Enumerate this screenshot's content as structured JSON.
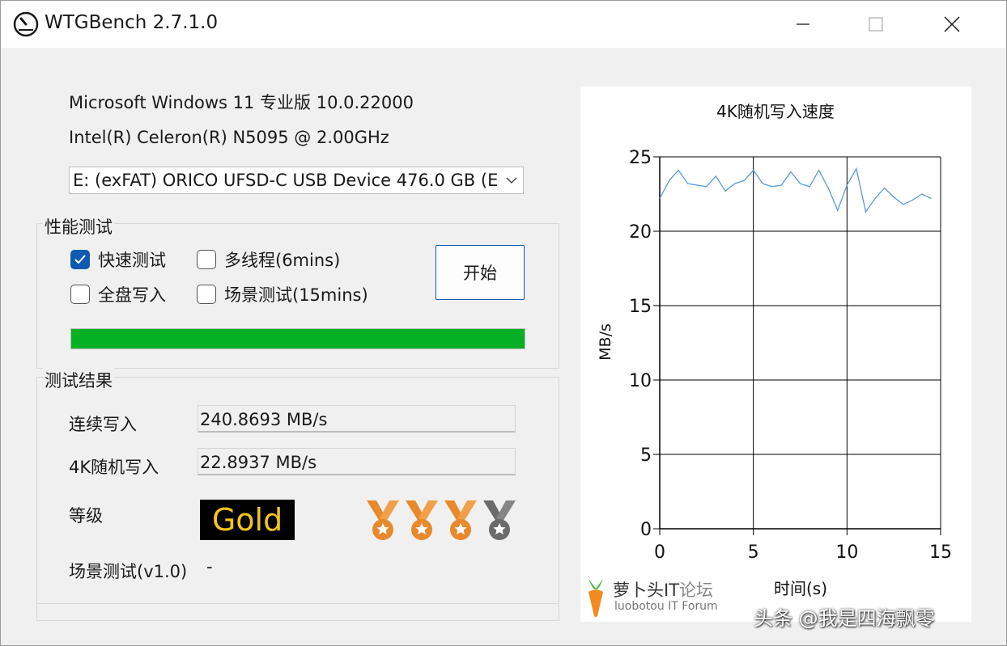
{
  "window": {
    "title": "WTGBench 2.7.1.0"
  },
  "system": {
    "os": "Microsoft Windows 11 专业版 10.0.22000",
    "cpu": "Intel(R) Celeron(R) N5095 @ 2.00GHz",
    "drive_selected": "E:  (exFAT) ORICO UFSD-C USB Device 476.0 GB (E"
  },
  "perf_test": {
    "title": "性能测试",
    "options": [
      {
        "label": "快速测试",
        "checked": true
      },
      {
        "label": "多线程(6mins)",
        "checked": false
      },
      {
        "label": "全盘写入",
        "checked": false
      },
      {
        "label": "场景测试(15mins)",
        "checked": false
      }
    ],
    "start_label": "开始",
    "progress": 1.0,
    "progress_color": "#06b025"
  },
  "results": {
    "title": "测试结果",
    "seq_write_label": "连续写入",
    "seq_write_value": "240.8693 MB/s",
    "rand4k_label": "4K随机写入",
    "rand4k_value": "22.8937 MB/s",
    "grade_label": "等级",
    "grade_value": "Gold",
    "scene_label": "场景测试(v1.0)",
    "scene_value": "-",
    "medals": [
      "orange",
      "orange",
      "orange",
      "gray"
    ]
  },
  "chart_data": {
    "type": "line",
    "title": "4K随机写入速度",
    "xlabel": "时间(s)",
    "ylabel": "MB/s",
    "xlim": [
      0,
      15
    ],
    "ylim": [
      0,
      25
    ],
    "xticks": [
      "0",
      "5",
      "10",
      "15"
    ],
    "yticks": [
      "0",
      "5",
      "10",
      "15",
      "20",
      "25"
    ],
    "grid": true,
    "series": [
      {
        "color": "#5b9bd5",
        "x": [
          0,
          0.5,
          1,
          1.5,
          2,
          2.5,
          3,
          3.5,
          4,
          4.5,
          5,
          5.5,
          6,
          6.5,
          7,
          7.5,
          8,
          8.5,
          9,
          9.5,
          10,
          10.5,
          11,
          11.5,
          12,
          12.5,
          13,
          13.5,
          14,
          14.5
        ],
        "y": [
          22.2,
          23.4,
          24.1,
          23.2,
          23.1,
          23.0,
          23.7,
          22.7,
          23.2,
          23.4,
          24.1,
          23.2,
          23.0,
          23.1,
          24.0,
          23.2,
          23.0,
          24.1,
          22.9,
          21.4,
          23.1,
          24.2,
          21.3,
          22.2,
          22.9,
          22.3,
          21.8,
          22.1,
          22.5,
          22.2
        ]
      }
    ]
  },
  "logo": {
    "name": "萝卜头IT",
    "name_suffix": "论坛",
    "sub": "luobotou IT Forum"
  },
  "watermark": "头条 @我是四海飘零"
}
